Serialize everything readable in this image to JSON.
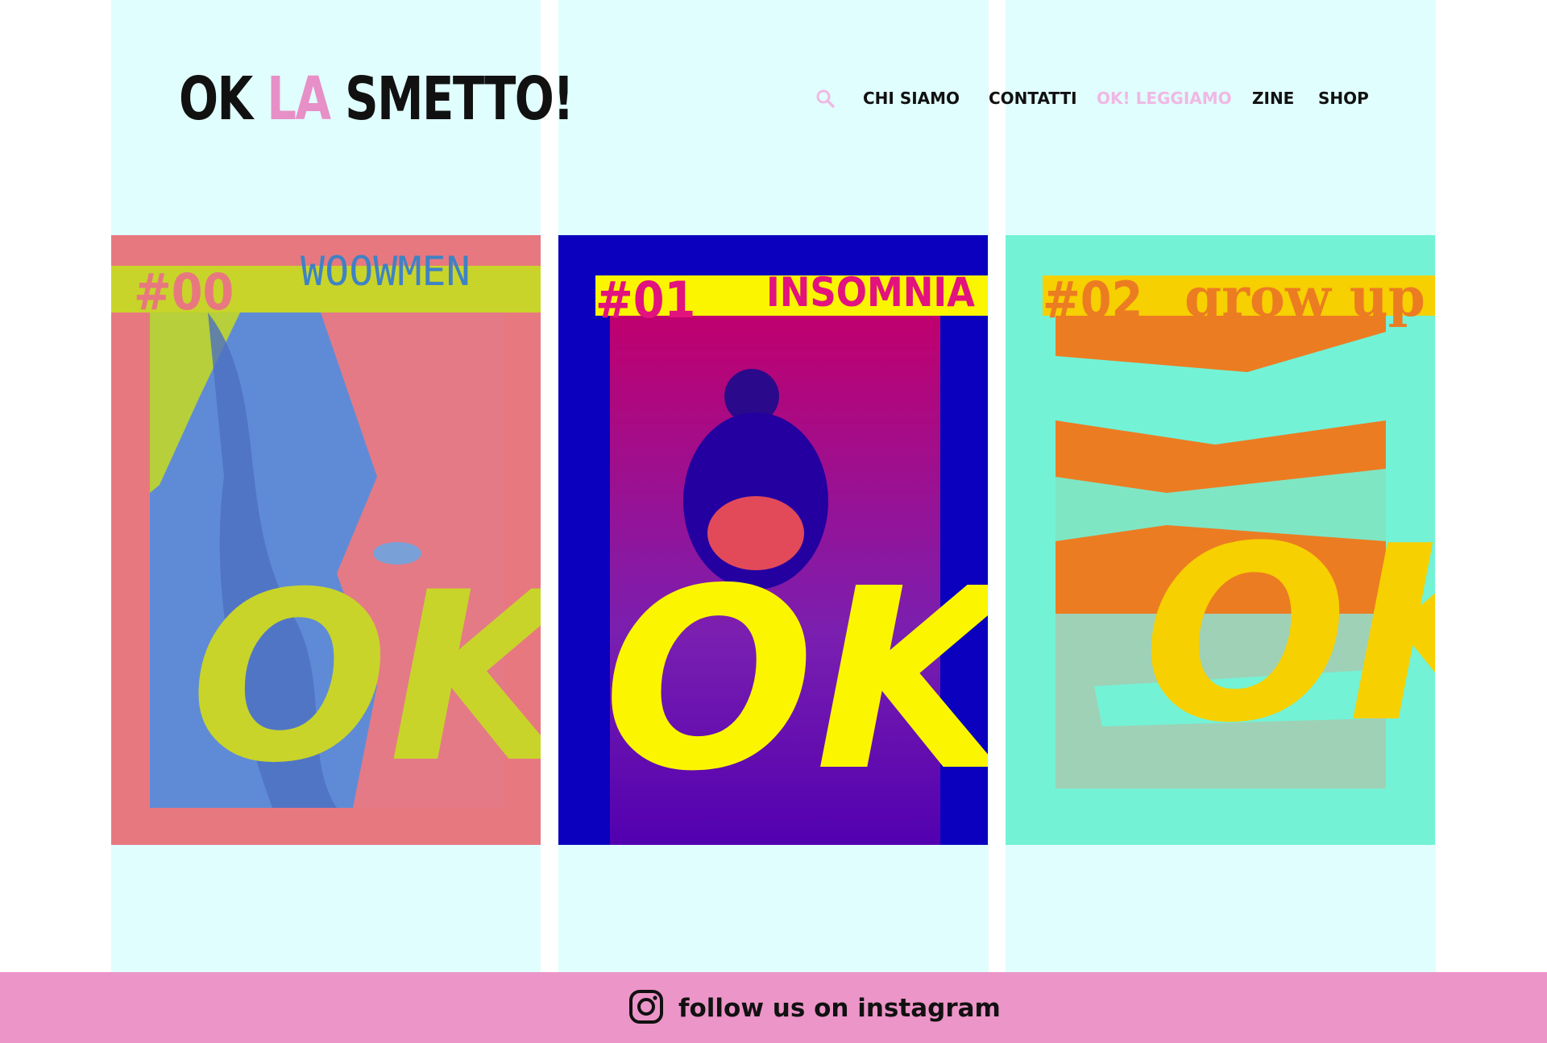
{
  "brand": {
    "logo_ok": "OK",
    "logo_la": "LA",
    "logo_rest": "SMETTO!"
  },
  "nav": {
    "search_icon": "search-icon",
    "items": [
      {
        "label": "CHI SIAMO",
        "active": false
      },
      {
        "label": "CONTATTI",
        "active": false
      },
      {
        "label": "OK! LEGGIAMO",
        "active": true
      },
      {
        "label": "ZINE",
        "active": false
      },
      {
        "label": "SHOP",
        "active": false
      }
    ]
  },
  "covers": [
    {
      "number": "#00",
      "title": "WOOWMEN",
      "mark": "OK!",
      "bg": "#e8787f",
      "band": "#c8d42a",
      "accent": "#3f82c4"
    },
    {
      "number": "#01",
      "title": "INSOMNIA",
      "mark": "OK!",
      "bg": "#0a00bd",
      "band": "#fbf600",
      "accent": "#e2127f"
    },
    {
      "number": "#02",
      "title": "grow up",
      "mark": "OK!",
      "bg": "#73f2d6",
      "band": "#f6d000",
      "accent": "#ec7c22"
    }
  ],
  "footer": {
    "instagram_icon": "instagram-icon",
    "text": "follow us on instagram",
    "bg": "#ec95c8"
  }
}
